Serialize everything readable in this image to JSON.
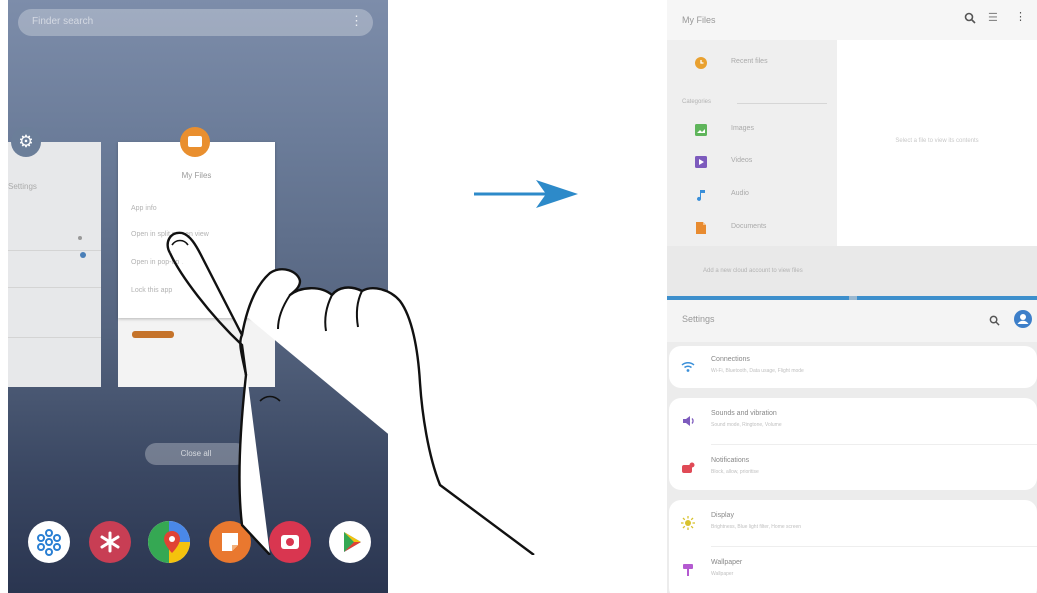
{
  "left_screen": {
    "finder_placeholder": "Finder search",
    "finder_more": "⋮",
    "settings_card": {
      "title": "Settings"
    },
    "myfiles_card": {
      "title": "My Files",
      "options": [
        "App info",
        "Open in split screen view",
        "Open in pop-up view",
        "Lock this app"
      ]
    },
    "close_all_label": "Close all",
    "dock_apps": [
      {
        "name": "SmartThings",
        "color": "#2a7fd3"
      },
      {
        "name": "Bixby Vision",
        "color": "#c83e54"
      },
      {
        "name": "Maps",
        "color": "#35a853"
      },
      {
        "name": "Samsung Notes",
        "color": "#e9782f"
      },
      {
        "name": "Screen Recorder",
        "color": "#d93650"
      },
      {
        "name": "Play Store",
        "color": "#ffffff"
      }
    ]
  },
  "right_screen": {
    "top_app": {
      "title": "My Files",
      "recent_label": "Recent files",
      "categories_label": "Categories",
      "items": [
        {
          "label": "Images",
          "icon": "image-icon",
          "color": "#5fb55b"
        },
        {
          "label": "Videos",
          "icon": "video-icon",
          "color": "#7d5bbd"
        },
        {
          "label": "Audio",
          "icon": "music-icon",
          "color": "#3a8fd9"
        },
        {
          "label": "Documents",
          "icon": "document-icon",
          "color": "#e88b30"
        }
      ],
      "empty_message": "Select a file to view its contents",
      "footer_text": "Add a new cloud account to view files"
    },
    "bottom_app": {
      "title": "Settings",
      "groups": [
        [
          {
            "title": "Connections",
            "subtitle": "Wi-Fi, Bluetooth, Data usage, Flight mode",
            "icon": "wifi-icon",
            "color": "#3a8fd9"
          }
        ],
        [
          {
            "title": "Sounds and vibration",
            "subtitle": "Sound mode, Ringtone, Volume",
            "icon": "sound-icon",
            "color": "#7d5bbd"
          },
          {
            "title": "Notifications",
            "subtitle": "Block, allow, prioritise",
            "icon": "notifications-icon",
            "color": "#e04a56"
          }
        ],
        [
          {
            "title": "Display",
            "subtitle": "Brightness, Blue light filter, Home screen",
            "icon": "display-icon",
            "color": "#d8c22f"
          },
          {
            "title": "Wallpaper",
            "subtitle": "Wallpaper",
            "icon": "wallpaper-icon",
            "color": "#b45ad1"
          }
        ]
      ]
    }
  },
  "colors": {
    "divider": "#3d8fcc",
    "arrow": "#2d8ac9"
  }
}
